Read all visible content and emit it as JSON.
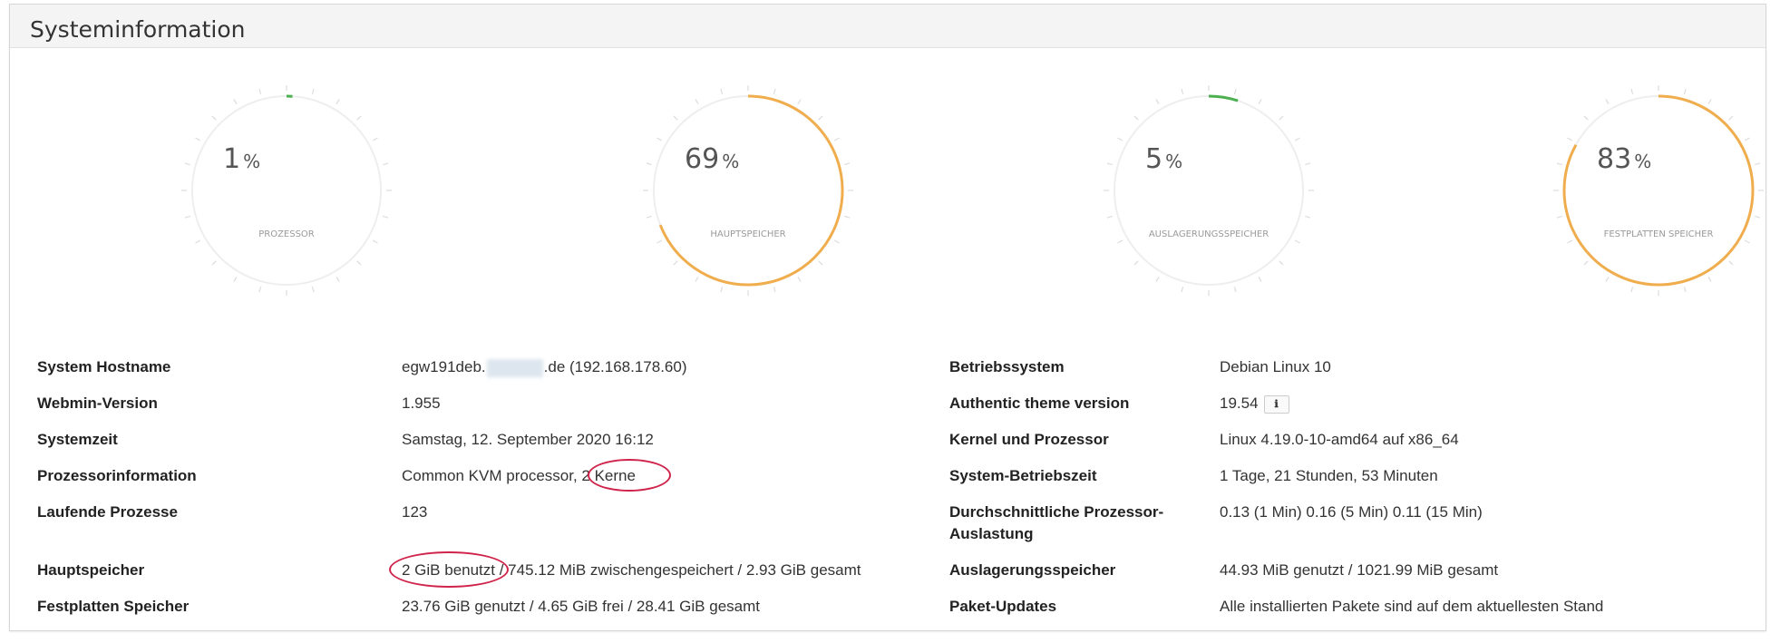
{
  "panel": {
    "title": "Systeminformation"
  },
  "gauges": [
    {
      "value": "1",
      "unit": "%",
      "percent": 1,
      "label": "Prozessor",
      "color": "#4caf50"
    },
    {
      "value": "69",
      "unit": "%",
      "percent": 69,
      "label": "Hauptspeicher",
      "color": "#f0ad4e"
    },
    {
      "value": "5",
      "unit": "%",
      "percent": 5,
      "label": "Auslagerungsspeicher",
      "color": "#4caf50"
    },
    {
      "value": "83",
      "unit": "%",
      "percent": 83,
      "label": "Festplatten Speicher",
      "color": "#f0ad4e"
    }
  ],
  "info_left": [
    {
      "label": "System Hostname",
      "value_prefix": "egw191deb.",
      "value_suffix": ".de (192.168.178.60)"
    },
    {
      "label": "Webmin-Version",
      "value": "1.955"
    },
    {
      "label": "Systemzeit",
      "value": "Samstag, 12. September 2020 16:12"
    },
    {
      "label": "Prozessorinformation",
      "value": "Common KVM processor, 2 Kerne"
    },
    {
      "label": "Laufende Prozesse",
      "value": "123"
    },
    {
      "label": "Hauptspeicher",
      "value": "2 GiB benutzt / 745.12 MiB zwischengespeichert / 2.93 GiB gesamt"
    },
    {
      "label": "Festplatten Speicher",
      "value": "23.76 GiB genutzt / 4.65 GiB frei / 28.41 GiB gesamt"
    }
  ],
  "info_right": [
    {
      "label": "Betriebssystem",
      "value": "Debian Linux 10"
    },
    {
      "label": "Authentic theme version",
      "value": "19.54"
    },
    {
      "label": "Kernel und Prozessor",
      "value": "Linux 4.19.0-10-amd64 auf x86_64"
    },
    {
      "label": "System-Betriebszeit",
      "value": "1 Tage, 21 Stunden, 53 Minuten"
    },
    {
      "label_line1": "Durchschnittliche Prozessor-",
      "label_line2": "Auslastung",
      "value": "0.13 (1 Min) 0.16 (5 Min) 0.11 (15 Min)"
    },
    {
      "label": "Auslagerungsspeicher",
      "value": "44.93 MiB genutzt / 1021.99 MiB gesamt"
    },
    {
      "label": "Paket-Updates",
      "value": "Alle installierten Pakete sind auf dem aktuellesten Stand"
    }
  ],
  "icons": {
    "info": "info-icon"
  },
  "colors": {
    "link": "#2a6aa8",
    "annotation": "#d0234a",
    "track": "#eeeeee"
  }
}
